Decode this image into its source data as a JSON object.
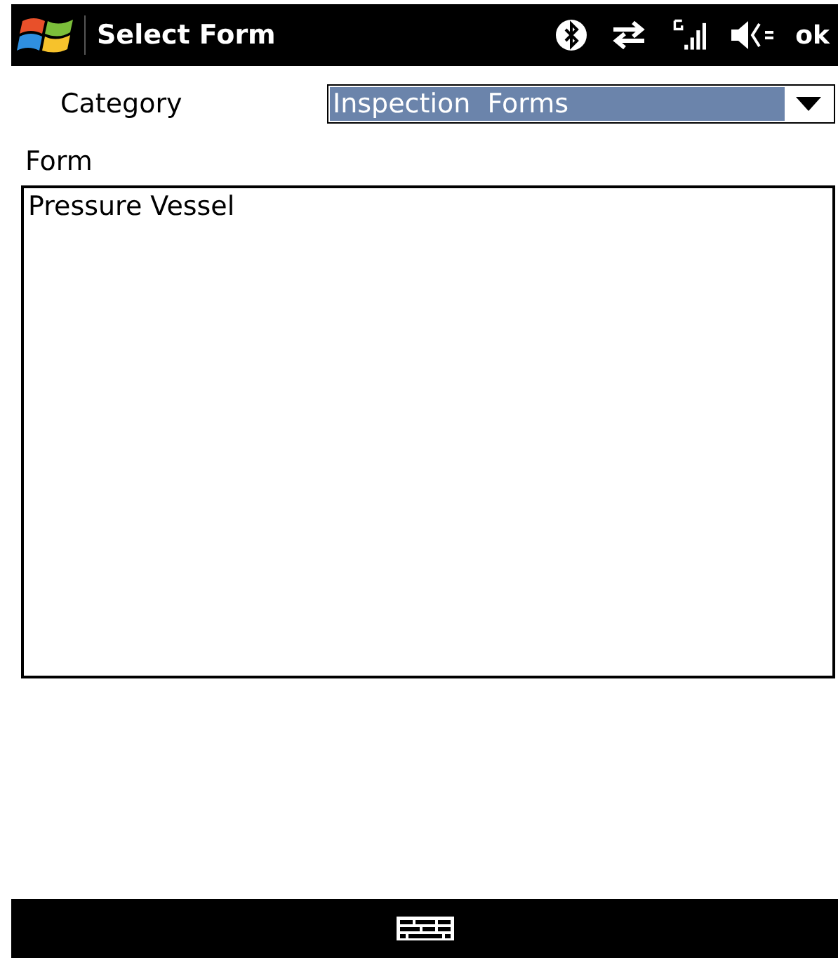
{
  "title_bar": {
    "title": "Select Form",
    "ok": "ok"
  },
  "category": {
    "label": "Category",
    "value": "Inspection  Forms",
    "highlighted": true
  },
  "form": {
    "label": "Form",
    "items": [
      {
        "text": "Pressure Vessel"
      }
    ]
  }
}
